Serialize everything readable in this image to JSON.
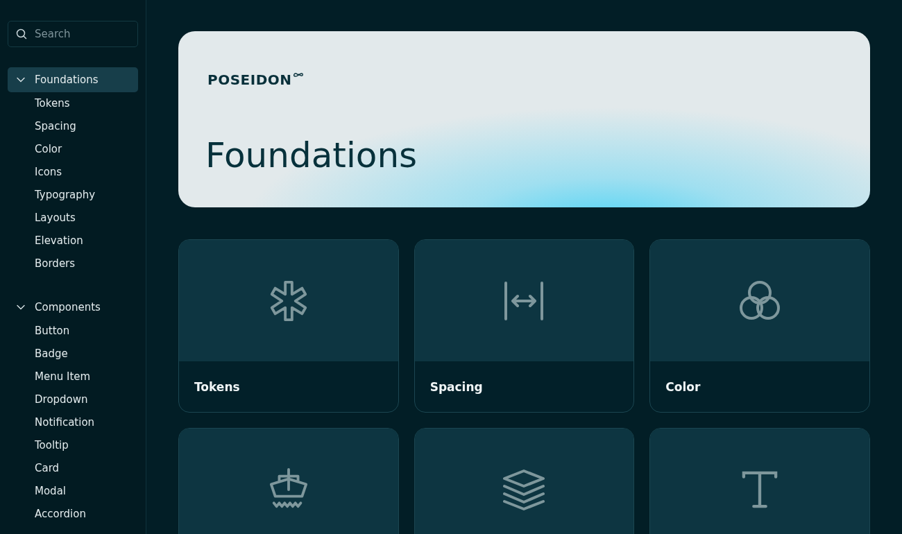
{
  "search": {
    "placeholder": "Search"
  },
  "sidebar": {
    "sections": [
      {
        "label": "Foundations",
        "expanded": true,
        "selected": true,
        "items": [
          {
            "label": "Tokens",
            "selected": false
          },
          {
            "label": "Spacing",
            "selected": false
          },
          {
            "label": "Color",
            "selected": false
          },
          {
            "label": "Icons",
            "selected": false
          },
          {
            "label": "Typography",
            "selected": false
          },
          {
            "label": "Layouts",
            "selected": false
          },
          {
            "label": "Elevation",
            "selected": false
          },
          {
            "label": "Borders",
            "selected": false
          }
        ]
      },
      {
        "label": "Components",
        "expanded": true,
        "selected": false,
        "items": [
          {
            "label": "Button",
            "selected": false
          },
          {
            "label": "Badge",
            "selected": false
          },
          {
            "label": "Menu Item",
            "selected": false
          },
          {
            "label": "Dropdown",
            "selected": false
          },
          {
            "label": "Notification",
            "selected": false
          },
          {
            "label": "Tooltip",
            "selected": false
          },
          {
            "label": "Card",
            "selected": false
          },
          {
            "label": "Modal",
            "selected": false
          },
          {
            "label": "Accordion",
            "selected": false
          }
        ]
      }
    ]
  },
  "hero": {
    "brand": "POSEIDON",
    "title": "Foundations"
  },
  "cards": [
    {
      "kind": "asterisk",
      "title": "Tokens"
    },
    {
      "kind": "spacing",
      "title": "Spacing"
    },
    {
      "kind": "circles",
      "title": "Color"
    },
    {
      "kind": "ship"
    },
    {
      "kind": "layers"
    },
    {
      "kind": "type"
    }
  ]
}
